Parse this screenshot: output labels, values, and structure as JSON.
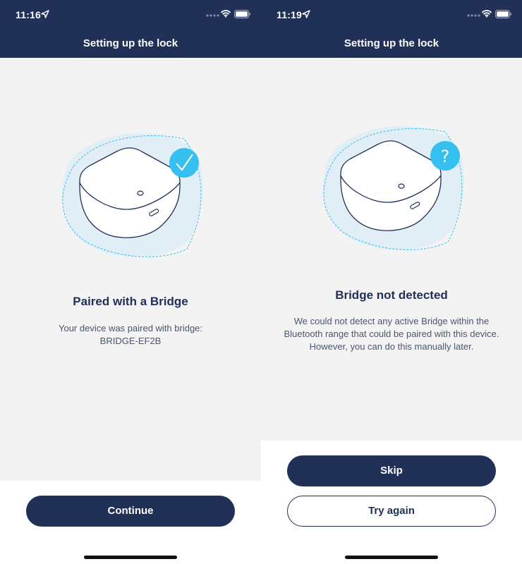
{
  "colors": {
    "header_bg": "#213057",
    "content_bg": "#f3f3f4",
    "accent": "#35c0ef",
    "text_primary": "#213057",
    "text_secondary": "#4a5571"
  },
  "left_screen": {
    "status_bar": {
      "time": "11:16",
      "icons": [
        "location-arrow-icon",
        "signal-dots-icon",
        "wifi-icon",
        "battery-icon"
      ]
    },
    "header": {
      "title": "Setting up the lock"
    },
    "illustration": {
      "badge_icon": "checkmark-icon"
    },
    "heading": "Paired with a Bridge",
    "description_line1": "Your device was paired with bridge:",
    "description_line2": "BRIDGE-EF2B",
    "buttons": {
      "continue": "Continue"
    }
  },
  "right_screen": {
    "status_bar": {
      "time": "11:19",
      "icons": [
        "location-arrow-icon",
        "signal-dots-icon",
        "wifi-icon",
        "battery-icon"
      ]
    },
    "header": {
      "title": "Setting up the lock"
    },
    "illustration": {
      "badge_icon": "question-mark-icon",
      "badge_text": "?"
    },
    "heading": "Bridge not detected",
    "description_line1": "We could not detect any active Bridge within the",
    "description_line2": "Bluetooth range that could be paired with this device.",
    "description_line3": "However, you can do this manually later.",
    "buttons": {
      "skip": "Skip",
      "try_again": "Try again"
    }
  }
}
